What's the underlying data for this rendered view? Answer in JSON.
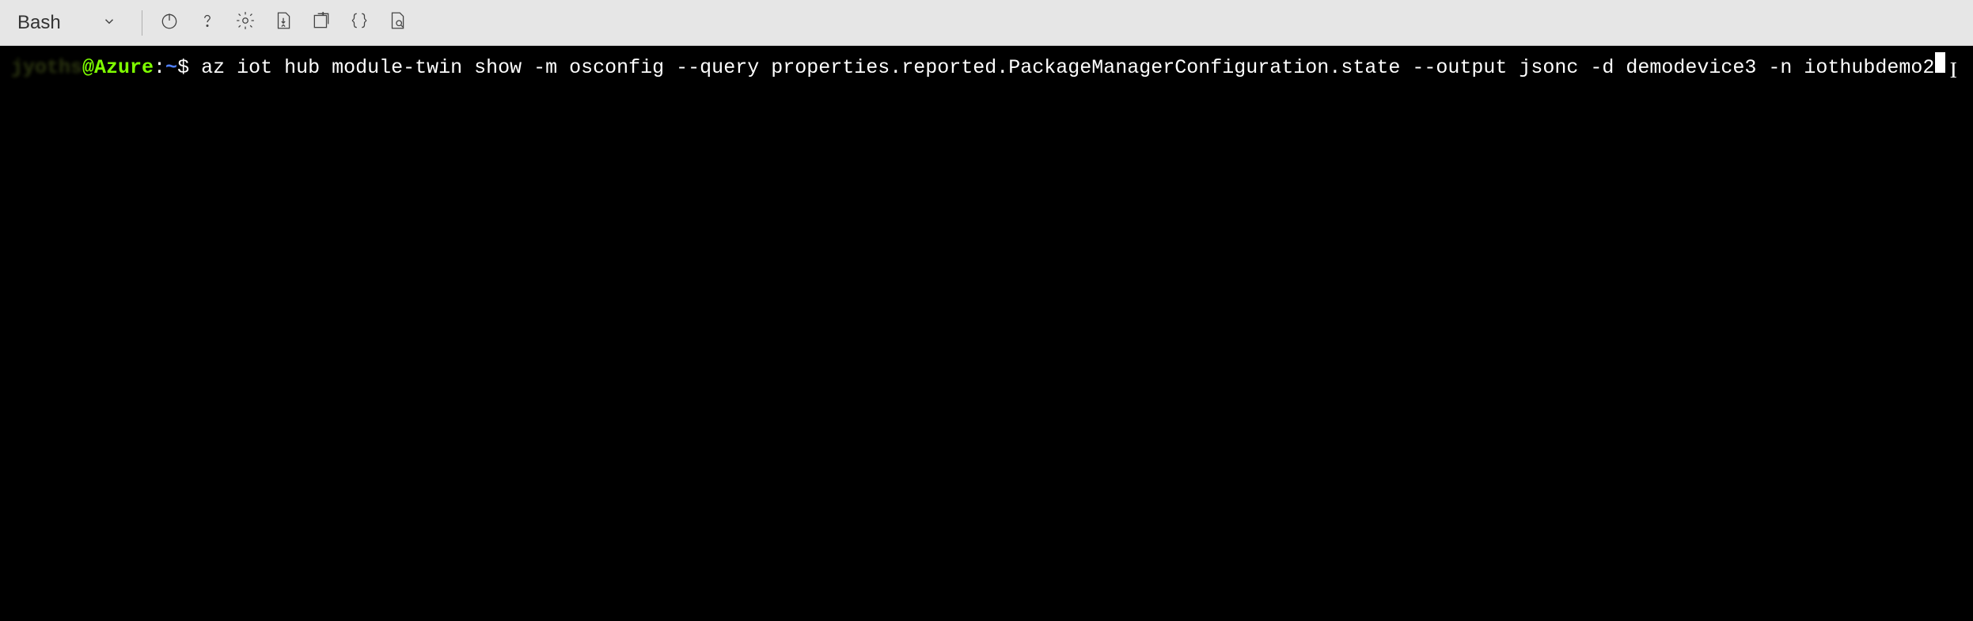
{
  "toolbar": {
    "shell_name": "Bash",
    "icons": {
      "chevron_down": "chevron-down-icon",
      "power": "power-icon",
      "help": "help-icon",
      "settings": "gear-icon",
      "upload_download": "upload-download-icon",
      "new_session": "new-session-icon",
      "braces": "braces-icon",
      "preview": "preview-icon"
    }
  },
  "terminal": {
    "prompt": {
      "user_obscured": "jyoths",
      "host": "@Azure",
      "separator": ":",
      "path": "~",
      "symbol": "$"
    },
    "command": " az iot hub module-twin show -m osconfig --query properties.reported.PackageManagerConfiguration.state --output jsonc -d demodevice3 -n iothubdemo2"
  }
}
